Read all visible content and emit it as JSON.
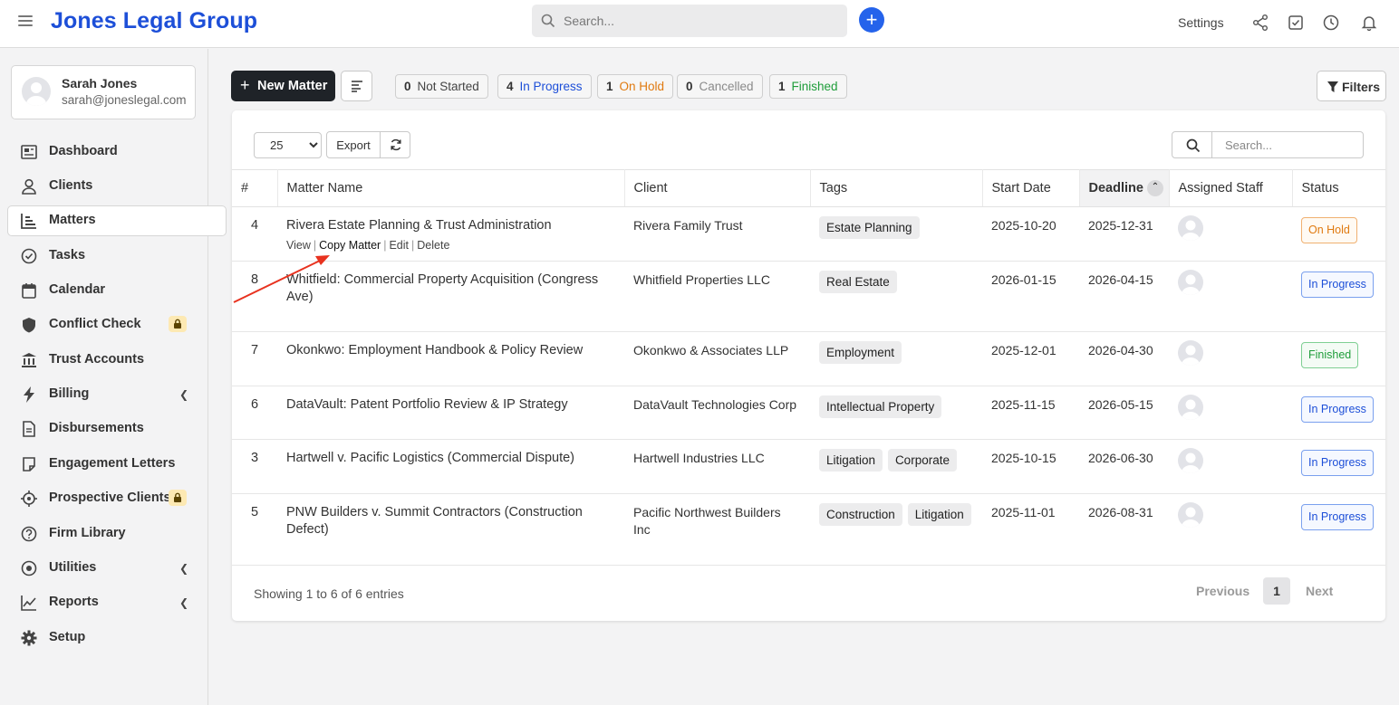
{
  "app": {
    "brand": "Jones Legal Group"
  },
  "header": {
    "search_placeholder": "Search...",
    "settings_label": "Settings",
    "add_label": "+"
  },
  "user": {
    "name": "Sarah Jones",
    "email": "sarah@joneslegal.com"
  },
  "sidebar": {
    "items": [
      {
        "label": "Dashboard",
        "icon": "dashboard-icon"
      },
      {
        "label": "Clients",
        "icon": "user-icon"
      },
      {
        "label": "Matters",
        "icon": "chart-icon",
        "active": true
      },
      {
        "label": "Tasks",
        "icon": "check-circle-icon"
      },
      {
        "label": "Calendar",
        "icon": "calendar-icon"
      },
      {
        "label": "Conflict Check",
        "icon": "shield-icon",
        "locked": true
      },
      {
        "label": "Trust Accounts",
        "icon": "bank-icon"
      },
      {
        "label": "Billing",
        "icon": "bolt-icon",
        "expandable": true
      },
      {
        "label": "Disbursements",
        "icon": "document-icon"
      },
      {
        "label": "Engagement Letters",
        "icon": "note-icon"
      },
      {
        "label": "Prospective Clients",
        "icon": "crosshair-icon",
        "locked": true
      },
      {
        "label": "Firm Library",
        "icon": "question-icon"
      },
      {
        "label": "Utilities",
        "icon": "dot-circle-icon",
        "expandable": true
      },
      {
        "label": "Reports",
        "icon": "line-chart-icon",
        "expandable": true
      },
      {
        "label": "Setup",
        "icon": "gear-icon"
      }
    ]
  },
  "toolbar": {
    "new_matter_label": "New Matter",
    "filters_label": "Filters",
    "stats": [
      {
        "count": "0",
        "label": "Not Started",
        "color": "#444444"
      },
      {
        "count": "4",
        "label": "In Progress",
        "color": "#1d4fd8"
      },
      {
        "count": "1",
        "label": "On Hold",
        "color": "#e07a10"
      },
      {
        "count": "0",
        "label": "Cancelled",
        "color": "#8a8a8a"
      },
      {
        "count": "1",
        "label": "Finished",
        "color": "#1f9d3a"
      }
    ]
  },
  "table_controls": {
    "page_size": "25",
    "export_label": "Export",
    "search_placeholder": "Search..."
  },
  "table": {
    "columns": [
      "#",
      "Matter Name",
      "Client",
      "Tags",
      "Start Date",
      "Deadline",
      "Assigned Staff",
      "Status"
    ],
    "sorted_column": "Deadline",
    "row_actions": [
      "View",
      "Copy Matter",
      "Edit",
      "Delete"
    ],
    "rows": [
      {
        "id": "4",
        "name": "Rivera Estate Planning & Trust Administration",
        "client": "Rivera Family Trust",
        "tags": [
          "Estate Planning"
        ],
        "start": "2025-10-20",
        "deadline": "2025-12-31",
        "status": "On Hold"
      },
      {
        "id": "8",
        "name": "Whitfield: Commercial Property Acquisition (Congress Ave)",
        "client": "Whitfield Properties LLC",
        "tags": [
          "Real Estate"
        ],
        "start": "2026-01-15",
        "deadline": "2026-04-15",
        "status": "In Progress"
      },
      {
        "id": "7",
        "name": "Okonkwo: Employment Handbook & Policy Review",
        "client": "Okonkwo & Associates LLP",
        "tags": [
          "Employment"
        ],
        "start": "2025-12-01",
        "deadline": "2026-04-30",
        "status": "Finished"
      },
      {
        "id": "6",
        "name": "DataVault: Patent Portfolio Review & IP Strategy",
        "client": "DataVault Technologies Corp",
        "tags": [
          "Intellectual Property"
        ],
        "start": "2025-11-15",
        "deadline": "2026-05-15",
        "status": "In Progress"
      },
      {
        "id": "3",
        "name": "Hartwell v. Pacific Logistics (Commercial Dispute)",
        "client": "Hartwell Industries LLC",
        "tags": [
          "Litigation",
          "Corporate"
        ],
        "start": "2025-10-15",
        "deadline": "2026-06-30",
        "status": "In Progress"
      },
      {
        "id": "5",
        "name": "PNW Builders v. Summit Contractors (Construction Defect)",
        "client": "Pacific Northwest Builders Inc",
        "tags": [
          "Construction",
          "Litigation"
        ],
        "start": "2025-11-01",
        "deadline": "2026-08-31",
        "status": "In Progress"
      }
    ]
  },
  "status_styles": {
    "On Hold": {
      "color": "#e07a10",
      "border": "#f0b070",
      "bg": "#fffaf3"
    },
    "In Progress": {
      "color": "#1d4fd8",
      "border": "#7aa0ee",
      "bg": "#f5f8ff"
    },
    "Finished": {
      "color": "#1f9d3a",
      "border": "#7fcf93",
      "bg": "#f4fbf5"
    }
  },
  "footer": {
    "showing_text": "Showing 1 to 6 of 6 entries",
    "prev_label": "Previous",
    "current_page": "1",
    "next_label": "Next"
  }
}
